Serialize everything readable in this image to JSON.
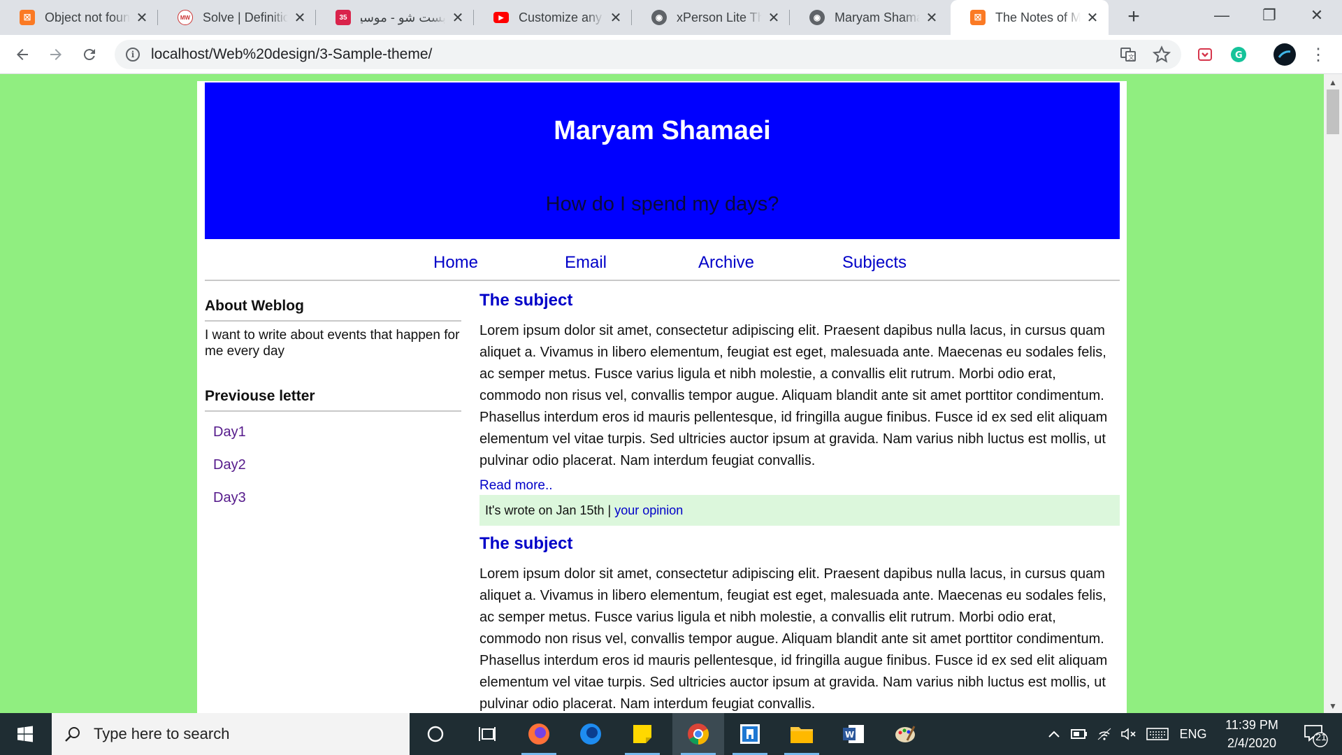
{
  "browser": {
    "tabs": [
      {
        "title": "Object not found!",
        "icon": "xampp-icon",
        "color": "#fb7a24"
      },
      {
        "title": "Solve | Definition",
        "icon": "merriam-webster-icon",
        "color": "#ffffff"
      },
      {
        "title": "بست شو - موسیقی",
        "icon": "site-icon",
        "color": "#d9234b"
      },
      {
        "title": "Customize any WordPress",
        "icon": "youtube-icon",
        "color": "#ff0000"
      },
      {
        "title": "xPerson Lite Theme",
        "icon": "globe-icon",
        "color": "#5f6368"
      },
      {
        "title": "Maryam Shamaei",
        "icon": "globe-icon",
        "color": "#5f6368"
      },
      {
        "title": "The Notes of Maryam",
        "icon": "xampp-icon",
        "color": "#fb7a24"
      }
    ],
    "url": "localhost/Web%20design/3-Sample-theme/"
  },
  "site": {
    "title": "Maryam Shamaei",
    "tagline": "How do I spend my days?",
    "nav": [
      "Home",
      "Email",
      "Archive",
      "Subjects"
    ]
  },
  "sidebar": {
    "about_heading": "About Weblog",
    "about_text": "I want to write about events that happen for me every day",
    "previous_heading": "Previouse letter",
    "previous_links": [
      "Day1",
      "Day2",
      "Day3"
    ]
  },
  "posts": [
    {
      "title": "The subject",
      "body": "Lorem ipsum dolor sit amet, consectetur adipiscing elit. Praesent dapibus nulla lacus, in cursus quam aliquet a. Vivamus in libero elementum, feugiat est eget, malesuada ante. Maecenas eu sodales felis, ac semper metus. Fusce varius ligula et nibh molestie, a convallis elit rutrum. Morbi odio erat, commodo non risus vel, convallis tempor augue. Aliquam blandit ante sit amet porttitor condimentum. Phasellus interdum eros id mauris pellentesque, id fringilla augue finibus. Fusce id ex sed elit aliquam elementum vel vitae turpis. Sed ultricies auctor ipsum at gravida. Nam varius nibh luctus est mollis, ut pulvinar odio placerat. Nam interdum feugiat convallis.",
      "read_more": "Read more..",
      "meta": "It's wrote on Jan 15th |",
      "opinion": "your opinion"
    },
    {
      "title": "The subject",
      "body": "Lorem ipsum dolor sit amet, consectetur adipiscing elit. Praesent dapibus nulla lacus, in cursus quam aliquet a. Vivamus in libero elementum, feugiat est eget, malesuada ante. Maecenas eu sodales felis, ac semper metus. Fusce varius ligula et nibh molestie, a convallis elit rutrum. Morbi odio erat, commodo non risus vel, convallis tempor augue. Aliquam blandit ante sit amet porttitor condimentum. Phasellus interdum eros id mauris pellentesque, id fringilla augue finibus. Fusce id ex sed elit aliquam elementum vel vitae turpis. Sed ultricies auctor ipsum at gravida. Nam varius nibh luctus est mollis, ut pulvinar odio placerat. Nam interdum feugiat convallis."
    }
  ],
  "taskbar": {
    "search_placeholder": "Type here to search",
    "language": "ENG",
    "time": "11:39 PM",
    "date": "2/4/2020",
    "notification_count": "21"
  },
  "colors": {
    "page_background": "#90ee80",
    "header_background": "#0000ff",
    "link": "#0000c8",
    "meta_background": "#dcf7dc"
  }
}
